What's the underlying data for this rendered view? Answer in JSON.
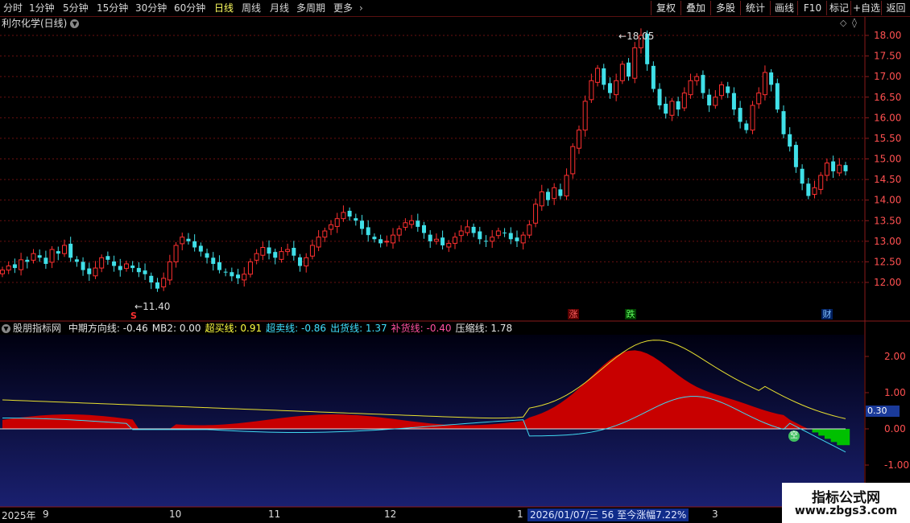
{
  "toolbar": {
    "tabs": [
      "分时",
      "1分钟",
      "5分钟",
      "15分钟",
      "30分钟",
      "60分钟",
      "日线",
      "周线",
      "月线",
      "多周期",
      "更多"
    ],
    "active_tab": "日线",
    "right_buttons": [
      "复权",
      "叠加",
      "多股",
      "统计",
      "画线",
      "F10",
      "标记",
      "+自选",
      "返回"
    ]
  },
  "stock": {
    "title": "利尔化学(日线)"
  },
  "price_chart": {
    "y_ticks": [
      "18.00",
      "17.50",
      "17.00",
      "16.50",
      "16.00",
      "15.50",
      "15.00",
      "14.50",
      "14.00",
      "13.50",
      "13.00",
      "12.50",
      "12.00"
    ],
    "high_label": "18.05",
    "low_label": "11.40",
    "markers": [
      "S",
      "涨",
      "跌",
      "财"
    ]
  },
  "indicator": {
    "name": "股朋指标网",
    "fields": [
      {
        "label": "中期方向线:",
        "value": "-0.46",
        "color": "#e6e6e6"
      },
      {
        "label": "MB2:",
        "value": "0.00",
        "color": "#e6e6e6"
      },
      {
        "label": "超买线:",
        "value": "0.91",
        "color": "#ffff40"
      },
      {
        "label": "超卖线:",
        "value": "-0.86",
        "color": "#40e0ff"
      },
      {
        "label": "出货线:",
        "value": "1.37",
        "color": "#40e0ff"
      },
      {
        "label": "补货线:",
        "value": "-0.40",
        "color": "#ff50a0"
      },
      {
        "label": "压缩线:",
        "value": "1.78",
        "color": "#e6e6e6"
      }
    ],
    "y_ticks": [
      "2.00",
      "1.00",
      "0.00",
      "-1.00"
    ],
    "current_value": "0.30",
    "empty_marker": "空"
  },
  "time_axis": {
    "labels": [
      "2025年",
      "9",
      "10",
      "11",
      "12",
      "1",
      "3"
    ],
    "highlight": "2026/01/07/三 56 至今涨幅7.22%"
  },
  "watermark": {
    "line1": "指标公式网",
    "line2": "www.zbgs3.com"
  },
  "colors": {
    "up": "#ff3030",
    "down": "#40e0e8",
    "fill_red": "#c80000",
    "fill_green": "#00c000",
    "frame": "#8a1a1a"
  },
  "chart_data": {
    "type": "candlestick",
    "ylim": [
      11.4,
      18.2
    ],
    "close_series": [
      12.3,
      12.4,
      12.35,
      12.55,
      12.5,
      12.7,
      12.6,
      12.45,
      12.8,
      12.7,
      12.9,
      12.6,
      12.5,
      12.3,
      12.2,
      12.35,
      12.6,
      12.55,
      12.4,
      12.3,
      12.45,
      12.35,
      12.25,
      12.2,
      12.0,
      11.85,
      12.1,
      12.5,
      12.9,
      13.1,
      13.0,
      12.85,
      12.75,
      12.6,
      12.45,
      12.3,
      12.25,
      12.15,
      12.1,
      12.2,
      12.5,
      12.7,
      12.85,
      12.7,
      12.6,
      12.75,
      12.8,
      12.65,
      12.4,
      12.6,
      12.9,
      13.1,
      13.25,
      13.4,
      13.55,
      13.7,
      13.6,
      13.5,
      13.3,
      13.15,
      13.05,
      12.95,
      13.0,
      13.15,
      13.3,
      13.45,
      13.5,
      13.35,
      13.2,
      13.0,
      13.05,
      12.9,
      12.95,
      13.1,
      13.25,
      13.35,
      13.2,
      13.05,
      13.0,
      13.1,
      13.25,
      13.2,
      13.05,
      13.0,
      13.15,
      13.4,
      13.9,
      14.2,
      14.0,
      14.3,
      14.1,
      14.6,
      15.3,
      15.7,
      16.4,
      16.9,
      17.2,
      16.8,
      16.6,
      16.9,
      17.3,
      17.0,
      17.7,
      18.0,
      17.3,
      16.7,
      16.3,
      16.1,
      16.4,
      16.2,
      16.6,
      16.9,
      17.0,
      16.6,
      16.3,
      16.5,
      16.8,
      16.6,
      16.2,
      15.9,
      15.7,
      16.3,
      16.6,
      17.1,
      16.8,
      16.2,
      15.6,
      15.3,
      14.8,
      14.4,
      14.1,
      14.3,
      14.6,
      14.9,
      14.7,
      14.85,
      14.7
    ]
  }
}
